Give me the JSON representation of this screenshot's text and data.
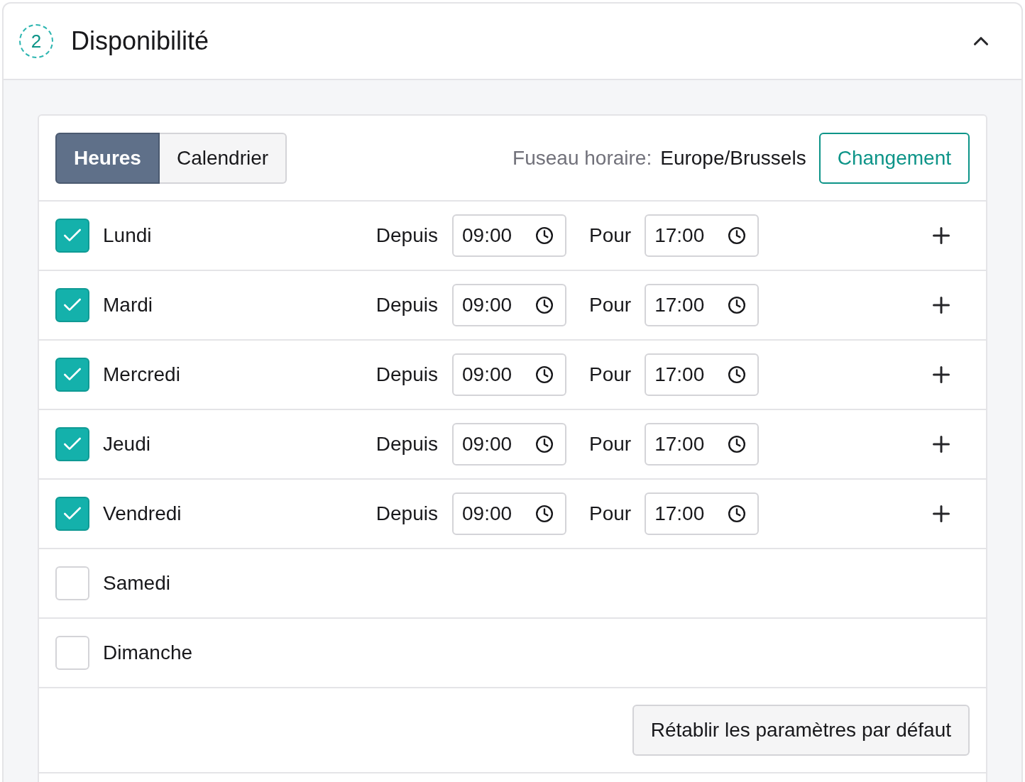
{
  "section": {
    "step": "2",
    "title": "Disponibilité",
    "expanded": true
  },
  "tabs": [
    {
      "label": "Heures",
      "selected": true
    },
    {
      "label": "Calendrier",
      "selected": false
    }
  ],
  "timezone": {
    "label": "Fuseau horaire:",
    "value": "Europe/Brussels",
    "button": "Changement"
  },
  "days": [
    {
      "name": "Lundi",
      "checked": true,
      "from_label": "Depuis",
      "from": "09:00",
      "to_label": "Pour",
      "to": "17:00"
    },
    {
      "name": "Mardi",
      "checked": true,
      "from_label": "Depuis",
      "from": "09:00",
      "to_label": "Pour",
      "to": "17:00"
    },
    {
      "name": "Mercredi",
      "checked": true,
      "from_label": "Depuis",
      "from": "09:00",
      "to_label": "Pour",
      "to": "17:00"
    },
    {
      "name": "Jeudi",
      "checked": true,
      "from_label": "Depuis",
      "from": "09:00",
      "to_label": "Pour",
      "to": "17:00"
    },
    {
      "name": "Vendredi",
      "checked": true,
      "from_label": "Depuis",
      "from": "09:00",
      "to_label": "Pour",
      "to": "17:00"
    },
    {
      "name": "Samedi",
      "checked": false
    },
    {
      "name": "Dimanche",
      "checked": false
    }
  ],
  "reset_button": "Rétablir les paramètres par défaut"
}
